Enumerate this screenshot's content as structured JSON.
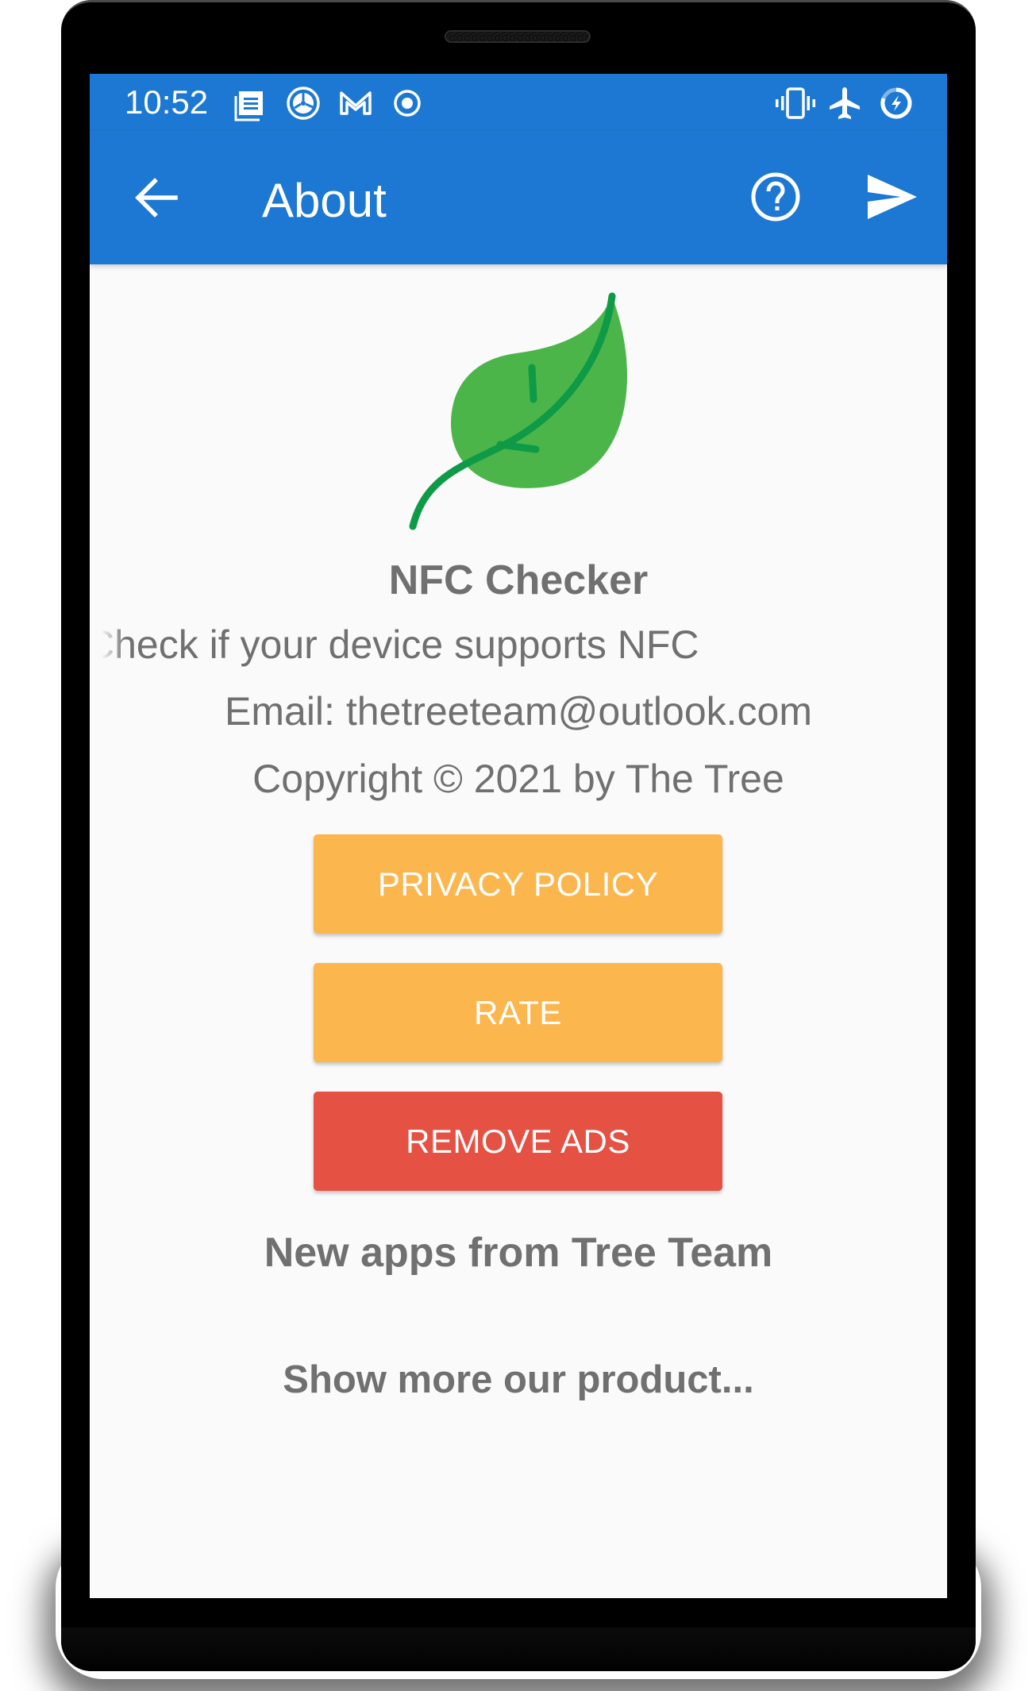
{
  "status_bar": {
    "time": "10:52",
    "left_icons": [
      "notes-icon",
      "aperture-icon",
      "gmail-icon",
      "record-icon"
    ],
    "right_icons": [
      "vibrate-icon",
      "airplane-mode-icon",
      "battery-charging-icon"
    ]
  },
  "app_bar": {
    "title": "About",
    "back_icon": "arrow-left-icon",
    "actions": [
      "help-icon",
      "send-icon"
    ],
    "color": "#1c78d2"
  },
  "about": {
    "logo": "leaf-icon",
    "app_name": "NFC Checker",
    "tagline": "Check if your device supports NFC",
    "email": "Email: thetreeteam@outlook.com",
    "copyright": "Copyright © 2021 by The Tree"
  },
  "buttons": {
    "privacy_policy": "PRIVACY POLICY",
    "rate": "RATE",
    "remove_ads": "REMOVE ADS",
    "primary_color": "#fcb64e",
    "danger_color": "#e55142"
  },
  "more_apps": {
    "heading": "New apps from Tree Team",
    "link": "Show more our product..."
  }
}
